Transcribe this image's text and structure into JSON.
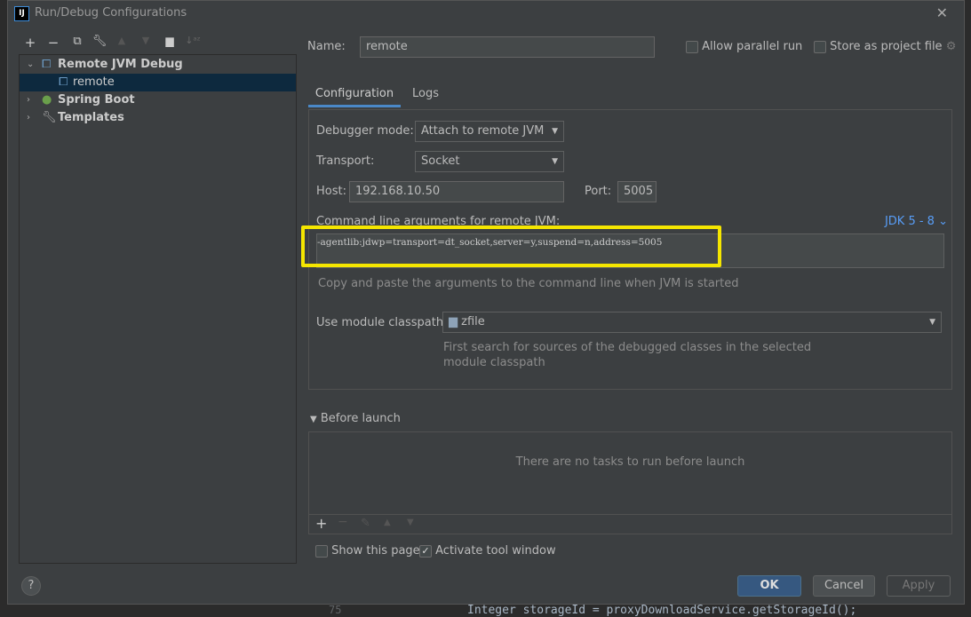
{
  "window": {
    "title": "Run/Debug Configurations",
    "app_icon": "IJ"
  },
  "toolbar": {
    "icons": [
      "plus-icon",
      "minus-icon",
      "copy-icon",
      "wrench-icon",
      "arrow-up-icon",
      "arrow-down-icon",
      "new-folder-icon",
      "sort-az-icon"
    ]
  },
  "tree": [
    {
      "label": "Remote JVM Debug",
      "expanded": true,
      "children": [
        {
          "label": "remote",
          "selected": true
        }
      ]
    },
    {
      "label": "Spring Boot",
      "expanded": false
    },
    {
      "label": "Templates",
      "expanded": false
    }
  ],
  "form": {
    "name_label": "Name:",
    "name_value": "remote",
    "allow_parallel": "Allow parallel run",
    "store_project": "Store as project file",
    "tabs": [
      "Configuration",
      "Logs"
    ],
    "debugger_mode_label": "Debugger mode:",
    "debugger_mode_value": "Attach to remote JVM",
    "transport_label": "Transport:",
    "transport_value": "Socket",
    "host_label": "Host:",
    "host_value": "192.168.10.50",
    "port_label": "Port:",
    "port_value": "5005",
    "cmd_label": "Command line arguments for remote JVM:",
    "jdk_label": "JDK 5 - 8",
    "cmd_value": "-agentlib:jdwp=transport=dt_socket,server=y,suspend=n,address=5005",
    "cmd_hint": "Copy and paste the arguments to the command line when JVM is started",
    "classpath_label": "Use module classpath:",
    "classpath_value": "zfile",
    "classpath_hint1": "First search for sources of the debugged classes in the selected",
    "classpath_hint2": "module classpath",
    "before_launch": "Before launch",
    "no_tasks": "There are no tasks to run before launch",
    "show_page": "Show this page",
    "activate_tool": "Activate tool window"
  },
  "buttons": {
    "ok": "OK",
    "cancel": "Cancel",
    "apply": "Apply",
    "help": "?"
  },
  "highlight_color": "#f5e600",
  "ide_background": {
    "line_number": "75",
    "code": "Integer storageId = proxyDownloadService.getStorageId();"
  }
}
